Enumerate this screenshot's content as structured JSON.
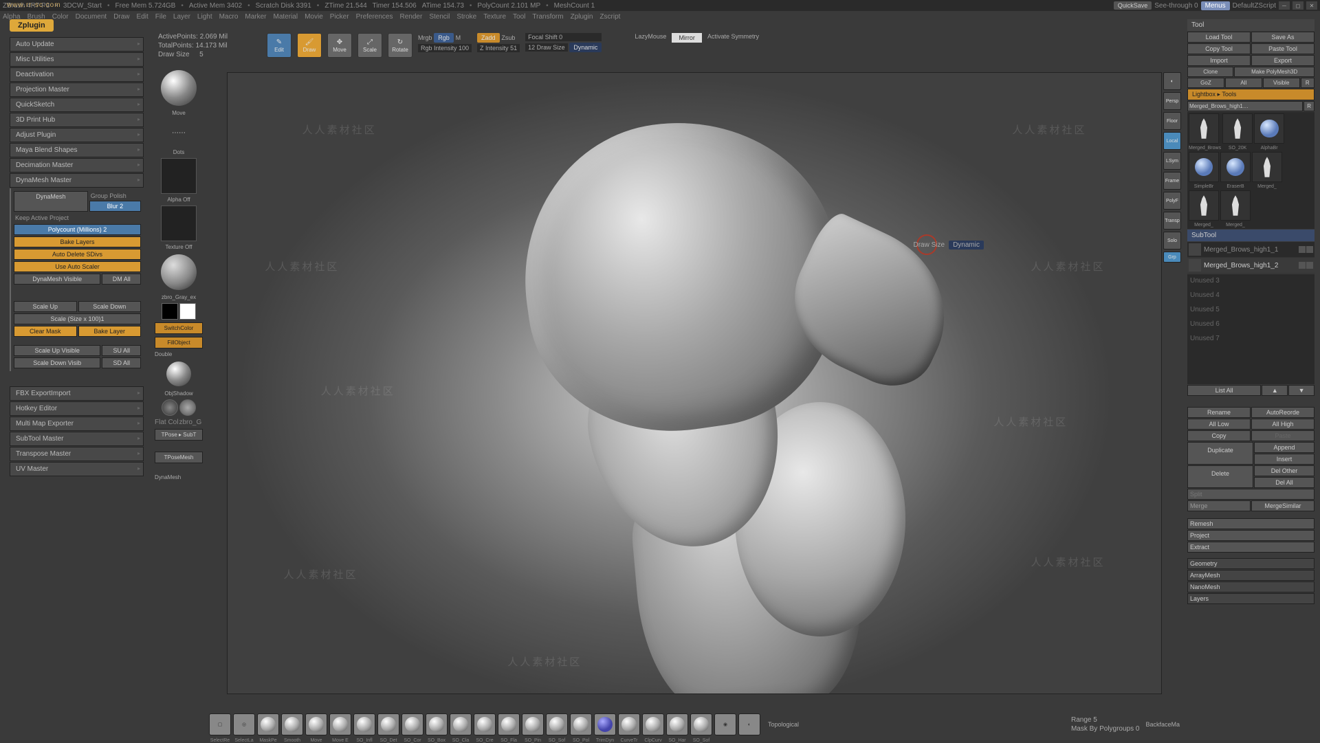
{
  "titlebar": {
    "app": "ZBrush 4R7 P3",
    "start": "3DCW_Start",
    "freemem": "Free Mem  5.724GB",
    "activemem": "Active Mem  3402",
    "scratch": "Scratch Disk  3391",
    "ztime": "ZTime  21.544",
    "timer": "Timer  154.506",
    "atime": "ATime  154.73",
    "polycount": "PolyCount  2.101 MP",
    "meshcount": "MeshCount  1",
    "quicksave": "QuickSave",
    "seethrough": "See-through  0",
    "menus": "Menus",
    "defaultscript": "DefaultZScript"
  },
  "menubar": {
    "items": [
      "Alpha",
      "Brush",
      "Color",
      "Document",
      "Draw",
      "Edit",
      "File",
      "Layer",
      "Light",
      "Macro",
      "Marker",
      "Material",
      "Movie",
      "Picker",
      "Preferences",
      "Render",
      "Stencil",
      "Stroke",
      "Texture",
      "Tool",
      "Transform",
      "Zplugin",
      "Zscript"
    ]
  },
  "zplugin": "Zplugin",
  "topshelf": {
    "active_pts": "ActivePoints:  2.069 Mil",
    "total_pts": "TotalPoints:  14.173 Mil",
    "draw_size_lbl": "Draw Size",
    "draw_size_val": "5",
    "edit": "Edit",
    "draw": "Draw",
    "move": "Move",
    "scale": "Scale",
    "rotate": "Rotate",
    "mrgb": "Mrgb",
    "rgb": "Rgb",
    "m": "M",
    "rgbint": "Rgb Intensity 100",
    "zadd": "Zadd",
    "zsub": "Zsub",
    "zint": "Z Intensity 51",
    "focal": "Focal Shift 0",
    "drawsizebox": "12 Draw Size",
    "dynamic": "Dynamic",
    "lazy": "LazyMouse",
    "mirror": "Mirror",
    "sym": "Activate Symmetry"
  },
  "left": {
    "items": [
      "Auto Update",
      "Misc Utilities",
      "Deactivation",
      "Projection Master",
      "QuickSketch",
      "3D Print Hub",
      "Adjust Plugin",
      "Maya Blend Shapes",
      "Decimation Master",
      "DynaMesh Master"
    ],
    "dynamesh": {
      "group_polish": "Group Polish",
      "dynamesh": "DynaMesh",
      "blur": "Blur 2",
      "keep": "Keep Active Project",
      "polycount": "Polycount (Millions) 2",
      "bake": "Bake Layers",
      "autodelete": "Auto Delete SDivs",
      "autoscaler": "Use Auto Scaler",
      "dm_vis": "DynaMesh Visible",
      "dm_all": "DM All",
      "scale_up": "Scale Up",
      "scale_down": "Scale Down",
      "scale_size": "Scale (Size x 100)1",
      "clear_mask": "Clear Mask",
      "bake_layer": "Bake Layer",
      "scale_up_vis": "Scale Up Visible",
      "su_all": "SU All",
      "scale_down_vis": "Scale Down Visib",
      "sd_all": "SD All"
    },
    "items2": [
      "FBX ExportImport",
      "Hotkey Editor",
      "Multi Map Exporter",
      "SubTool Master",
      "Transpose Master",
      "UV Master"
    ]
  },
  "brushcol": {
    "move": "Move",
    "dots": "Dots",
    "alpha_off": "Alpha Off",
    "texture_off": "Texture Off",
    "material": "zbro_Gray_ex",
    "switchcolor": "SwitchColor",
    "fillobject": "FillObject",
    "double": "Double",
    "objshadow": "ObjShadow",
    "flatcol": "Flat Col",
    "zbro": "zbro_G",
    "tpose_sub": "TPose ▸ SubT",
    "tposemesh": "TPoseMesh",
    "dynamesh": "DynaMesh"
  },
  "viewport": {
    "brush_label": "Draw Size",
    "brush_dyn": "Dynamic"
  },
  "rightnav": {
    "items_top": [
      "Persp",
      "Floor",
      "Local",
      "LSym",
      "Frame",
      "PolyF",
      "Transp",
      "Solo"
    ],
    "grp": "Grp"
  },
  "rpanel": {
    "tool": "Tool",
    "load": "Load Tool",
    "saveas": "Save As",
    "copy": "Copy Tool",
    "paste": "Paste Tool",
    "import": "Import",
    "export": "Export",
    "clone": "Clone",
    "polymesh": "Make PolyMesh3D",
    "goz": "GoZ",
    "all": "All",
    "visible": "Visible",
    "r": "R",
    "lightbox": "Lightbox ▸ Tools",
    "tools_lbl": "Merged_Brows_high1…",
    "rtn": "R",
    "thumbs": [
      "Merged_Brows",
      "SO_20K",
      "AlphaBr",
      "SimpleBr",
      "EraserB",
      "Merged_",
      "Merged_",
      "Merged_"
    ],
    "subtool": "SubTool",
    "st1": "Merged_Brows_high1_1",
    "st2": "Merged_Brows_high1_2",
    "unused": [
      "Unused 3",
      "Unused 4",
      "Unused 5",
      "Unused 6",
      "Unused 7"
    ],
    "list_all": "List All",
    "rename": "Rename",
    "autoreorder": "AutoReorde",
    "all_low": "All Low",
    "all_high": "All High",
    "copy2": "Copy",
    "paste2": "Paste",
    "duplicate": "Duplicate",
    "append": "Append",
    "insert": "Insert",
    "delete": "Delete",
    "del_other": "Del Other",
    "del_all": "Del All",
    "split": "Split",
    "merge": "Merge",
    "mergesimilar": "MergeSimilar",
    "remesh": "Remesh",
    "project": "Project",
    "extract": "Extract",
    "sections": [
      "Geometry",
      "ArrayMesh",
      "NanoMesh",
      "Layers"
    ]
  },
  "bottom": {
    "brushes": [
      "SelectRe",
      "SelectLa",
      "MaskPe",
      "Smooth",
      "Move",
      "Move E",
      "SO_Infl",
      "SO_Det",
      "SO_Cor",
      "SO_Box",
      "SO_Cla",
      "SO_Cre",
      "SO_Fla",
      "SO_Pin",
      "SO_Sof",
      "SO_Pol",
      "TrimDyn",
      "CurveTr",
      "ClpCurv",
      "SO_Har",
      "SO_Sof"
    ],
    "topological": "Topological",
    "range": "Range 5",
    "backface": "BackfaceMa",
    "maskpoly": "Mask By Polygroups 0"
  },
  "url": "www.rr-sc.com",
  "watermark": "人人素材社区"
}
